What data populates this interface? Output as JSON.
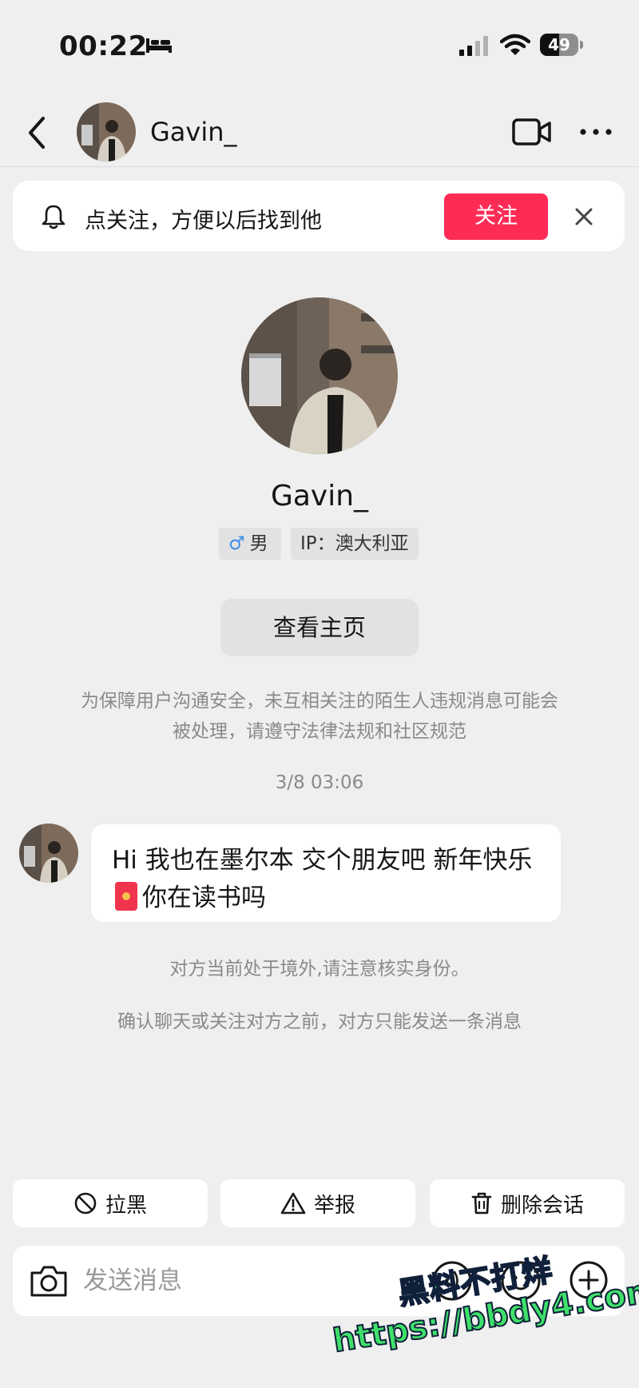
{
  "status_bar": {
    "time": "00:22",
    "battery_percent": 49,
    "battery_label": "49",
    "icons": [
      "sleep-bed-icon",
      "cellular-signal-icon",
      "wifi-icon",
      "battery-icon"
    ]
  },
  "nav": {
    "title": "Gavin_",
    "icons": [
      "back-arrow-icon",
      "video-call-icon",
      "more-dots-icon"
    ]
  },
  "follow_banner": {
    "text": "点关注，方便以后找到他",
    "button_label": "关注",
    "icons": [
      "bell-icon",
      "close-icon"
    ]
  },
  "profile": {
    "name": "Gavin_",
    "gender_symbol": "♂",
    "gender_label": "男",
    "ip_label": "IP：澳大利亚",
    "homepage_button": "查看主页"
  },
  "notices": {
    "safety": "为保障用户沟通安全，未互相关注的陌生人违规消息可能会被处理，请遵守法律法规和社区规范",
    "overseas": "对方当前处于境外,请注意核实身份。",
    "one_message_limit": "确认聊天或关注对方之前，对方只能发送一条消息"
  },
  "chat": {
    "timestamp": "3/8 03:06",
    "message_part1": "Hi 我也在墨尔本 交个朋友吧 新年快乐",
    "message_part2": "你在读书吗",
    "emoji": "red-envelope-emoji"
  },
  "actions": {
    "block_label": "拉黑",
    "report_label": "举报",
    "delete_label": "删除会话"
  },
  "composer": {
    "placeholder": "发送消息",
    "icons": [
      "camera-icon",
      "voice-icon",
      "emoji-icon",
      "plus-icon"
    ]
  },
  "watermark": {
    "line1": "黑料不打烊",
    "line2": "https://bbdy4.com"
  },
  "colors": {
    "background": "#efefef",
    "accent_follow": "#fe2c55",
    "gender_blue": "#3b8ee8",
    "watermark_green": "#3ee06a"
  }
}
